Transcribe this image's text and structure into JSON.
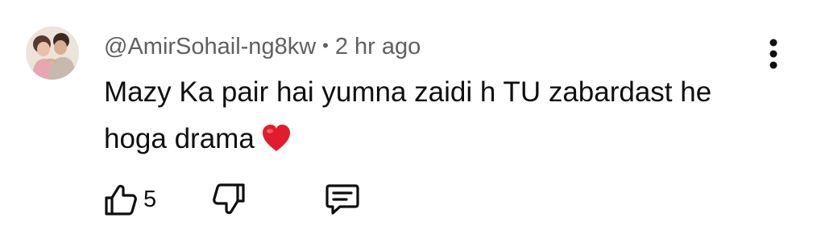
{
  "comment": {
    "author": "@AmirSohail-ng8kw",
    "separator": "•",
    "time": "2 hr ago",
    "text_line1": "Mazy Ka pair hai yumna zaidi h TU zabardast he",
    "text_line2": "hoga drama",
    "emoji": "red-heart",
    "like_count": "5"
  },
  "icons": {
    "more": "vertical-ellipsis-icon",
    "like": "thumbs-up-icon",
    "dislike": "thumbs-down-icon",
    "reply": "comment-reply-icon"
  },
  "colors": {
    "meta_text": "#606060",
    "body_text": "#0f0f0f",
    "heart": "#e11d2d"
  }
}
